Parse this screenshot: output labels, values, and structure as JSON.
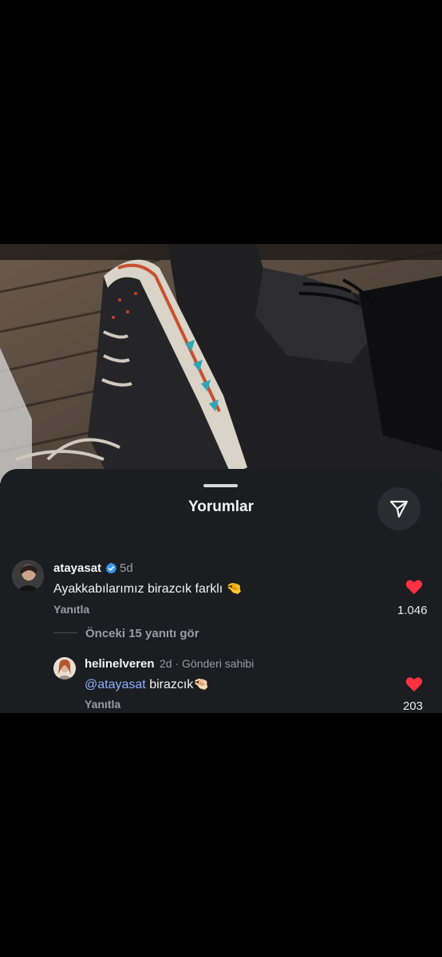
{
  "sheet": {
    "title": "Yorumlar"
  },
  "comments": [
    {
      "username": "atayasat",
      "verified": true,
      "time": "5d",
      "text": "Ayakkabılarımız birazcık farklı",
      "emoji": "🤏",
      "reply_label": "Yanıtla",
      "likes": "1.046"
    }
  ],
  "view_replies": "Önceki 15 yanıtı gör",
  "reply": {
    "username": "helinelveren",
    "time": "2d",
    "separator": "·",
    "author_tag": "Gönderi sahibi",
    "mention": "@atayasat",
    "text": "birazcık",
    "emoji": "🤏🏻",
    "reply_label": "Yanıtla",
    "likes": "203"
  },
  "colors": {
    "heart": "#ff3040",
    "verified": "#3897f0",
    "mention": "#8fb1ff"
  },
  "icons": {
    "share": "send-icon",
    "like": "heart-icon",
    "verified": "verified-badge-icon"
  }
}
